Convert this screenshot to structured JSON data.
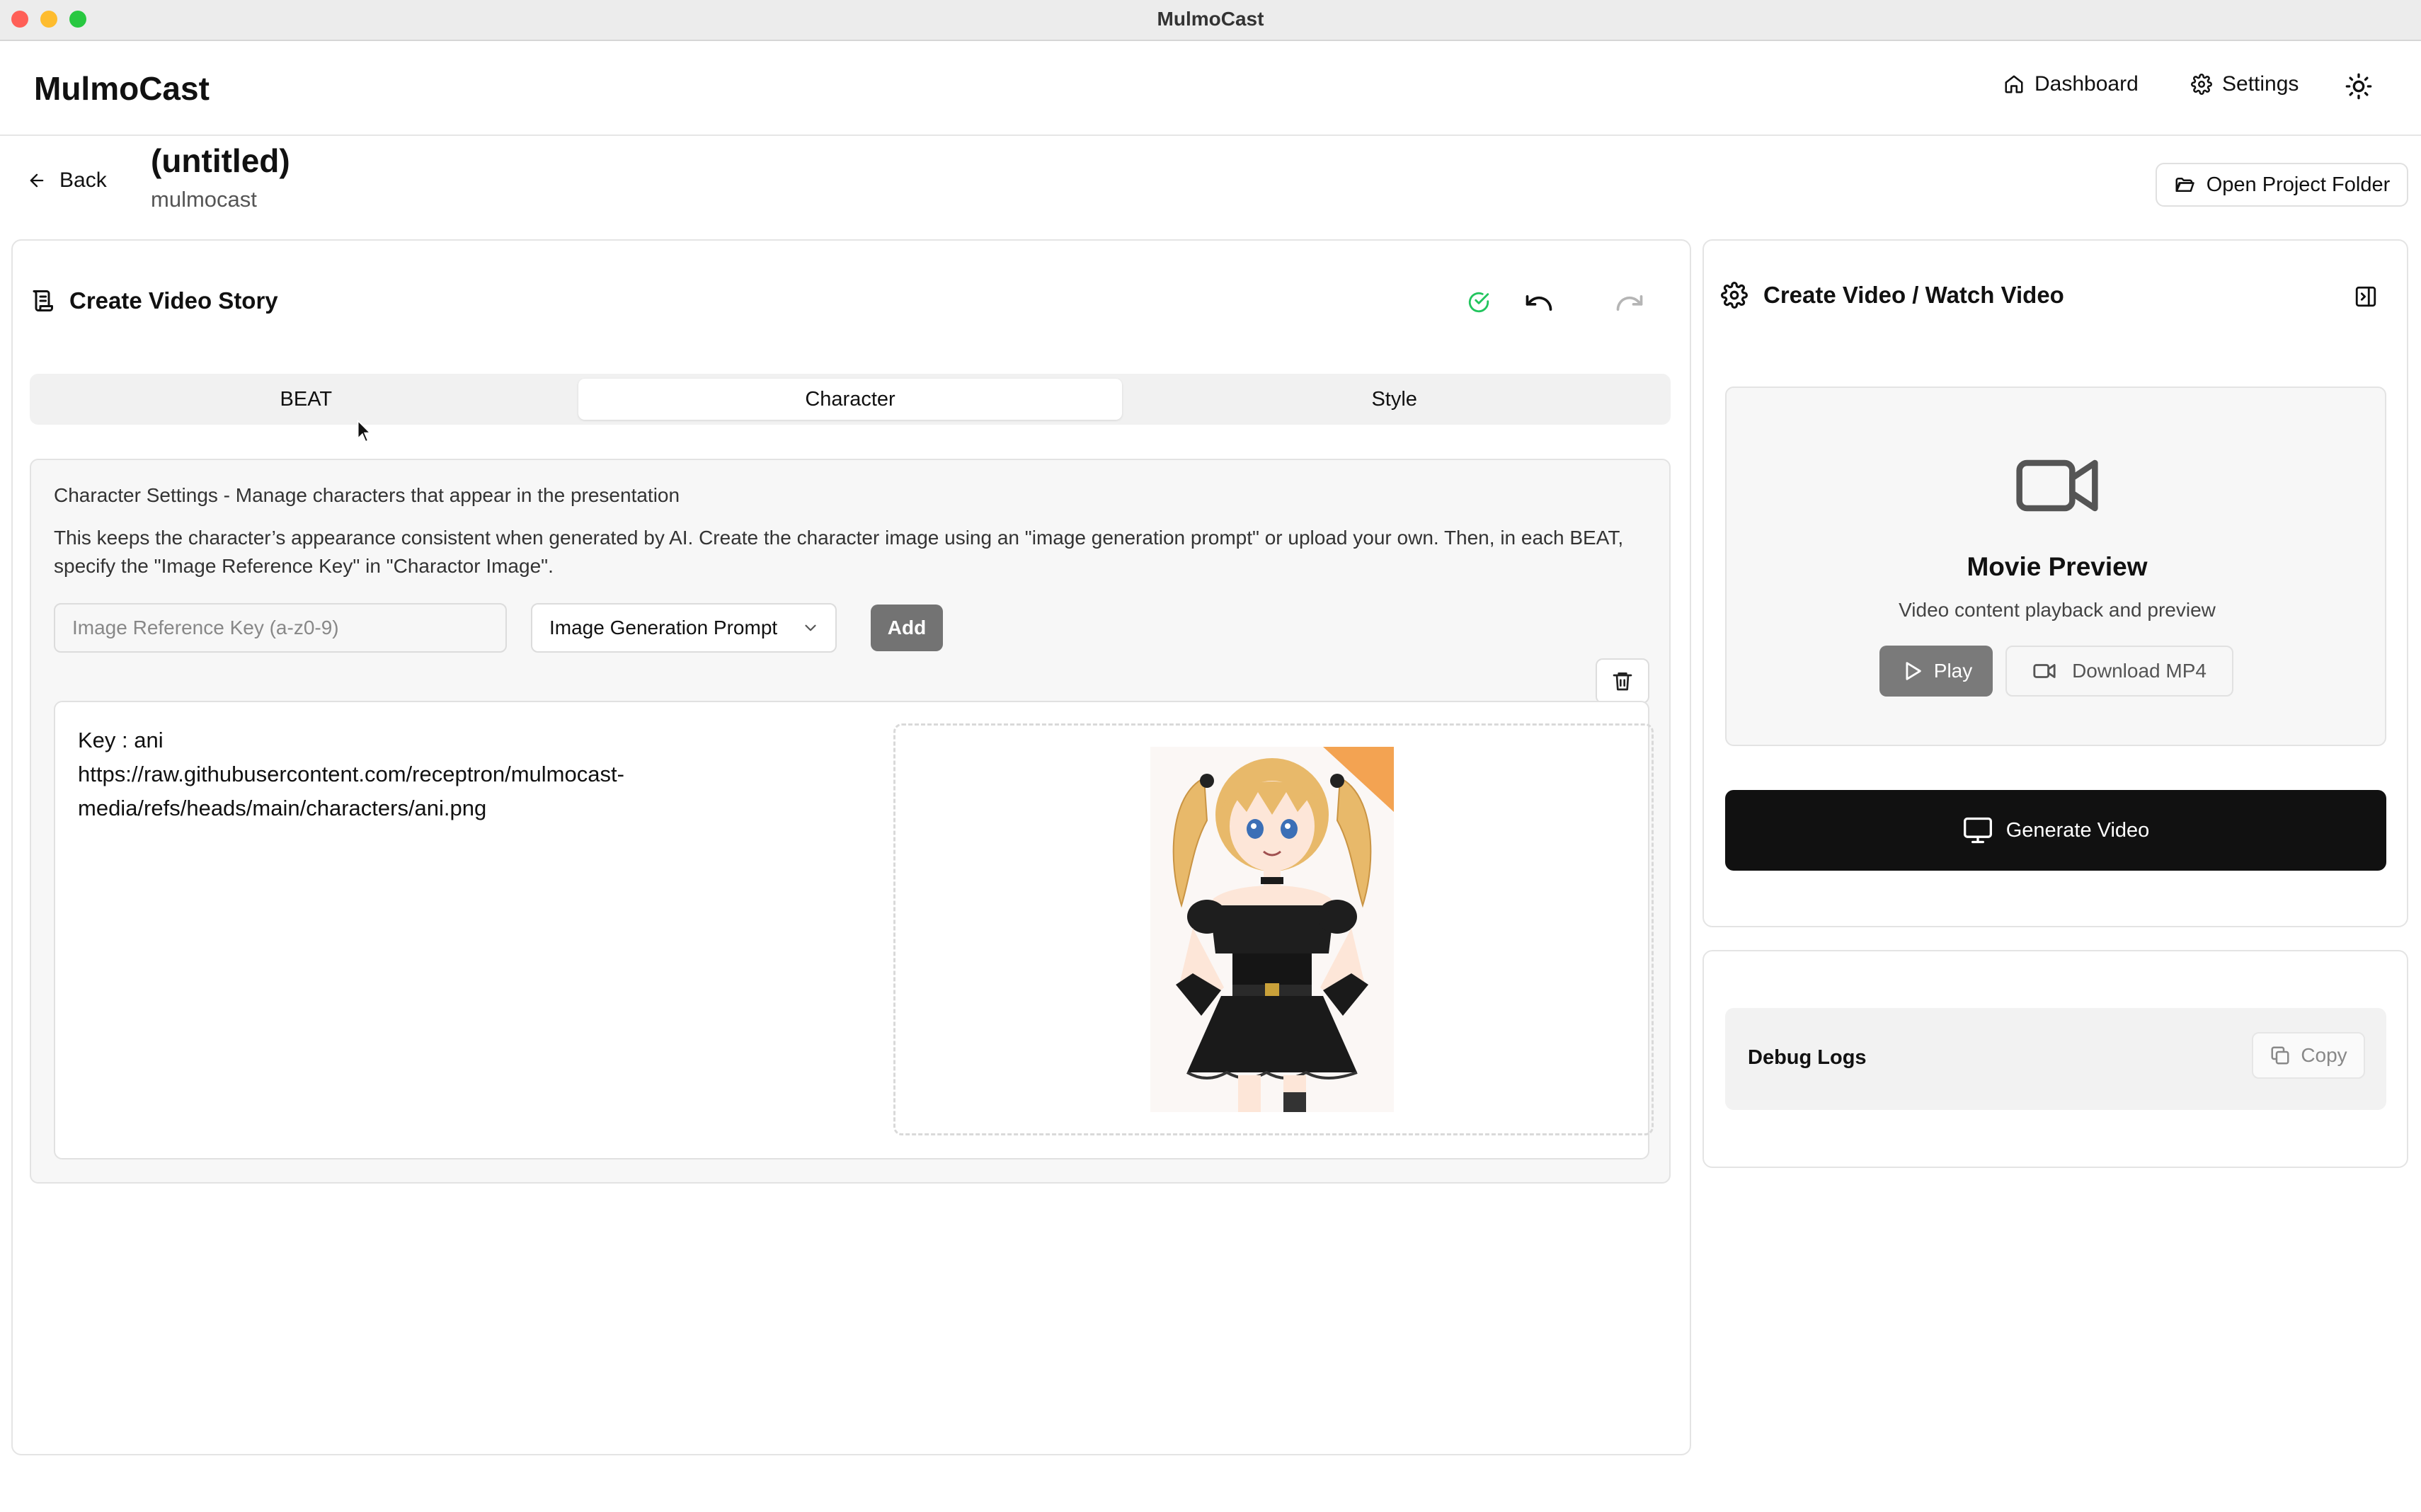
{
  "window": {
    "title": "MulmoCast"
  },
  "header": {
    "logo": "MulmoCast",
    "nav": {
      "dashboard": "Dashboard",
      "settings": "Settings"
    }
  },
  "project": {
    "back_label": "Back",
    "title": "(untitled)",
    "subtitle": "mulmocast",
    "open_folder_label": "Open Project Folder"
  },
  "editor": {
    "title": "Create Video Story",
    "tabs": [
      {
        "label": "BEAT",
        "active": false
      },
      {
        "label": "Character",
        "active": true
      },
      {
        "label": "Style",
        "active": false
      }
    ],
    "character": {
      "heading": "Character Settings - Manage characters that appear in the presentation",
      "description": "This keeps the character’s appearance consistent when generated by AI. Create the character image using an \"image generation prompt\" or upload your own. Then, in each BEAT, specify the \"Image Reference Key\" in \"Charactor Image\".",
      "key_placeholder": "Image Reference Key (a-z0-9)",
      "type_select": "Image Generation Prompt",
      "add_label": "Add",
      "card": {
        "key_line": "Key : ani",
        "url": "https://raw.githubusercontent.com/receptron/mulmocast-media/refs/heads/main/characters/ani.png"
      }
    }
  },
  "right_panel": {
    "title": "Create Video / Watch Video",
    "preview": {
      "title": "Movie Preview",
      "subtitle": "Video content playback and preview",
      "play_label": "Play",
      "download_label": "Download MP4"
    },
    "generate_label": "Generate Video",
    "debug": {
      "label": "Debug Logs",
      "copy_label": "Copy"
    }
  },
  "colors": {
    "accent_dark": "#111111",
    "success": "#22c55e",
    "disabled_button": "#737373"
  }
}
